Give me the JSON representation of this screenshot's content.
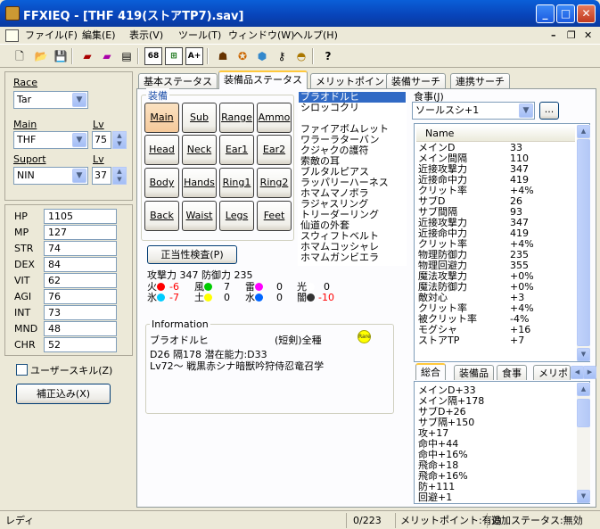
{
  "window": {
    "title": "FFXIEQ - [THF 419(ストアTP7).sav]",
    "min": "_",
    "max": "□",
    "close": "✕"
  },
  "menu": [
    "ファイル(F)",
    "編集(E)",
    "表示(V)",
    "ツール(T)",
    "ウィンドウ(W)",
    "ヘルプ(H)"
  ],
  "mdi": {
    "min": "–",
    "restore": "❐",
    "close": "✕"
  },
  "toolbar": {
    "b68": "68",
    "bA": "A+"
  },
  "left": {
    "race_label": "Race",
    "race_value": "Tar",
    "main_label": "Main",
    "main_value": "THF",
    "lv_label": "Lv",
    "main_lv": "75",
    "support_label": "Suport",
    "support_value": "NIN",
    "support_lv": "37",
    "stats": [
      {
        "name": "HP",
        "value": "1105"
      },
      {
        "name": "MP",
        "value": "127"
      },
      {
        "name": "STR",
        "value": "74"
      },
      {
        "name": "DEX",
        "value": "84"
      },
      {
        "name": "VIT",
        "value": "62"
      },
      {
        "name": "AGI",
        "value": "76"
      },
      {
        "name": "INT",
        "value": "73"
      },
      {
        "name": "MND",
        "value": "48"
      },
      {
        "name": "CHR",
        "value": "52"
      }
    ],
    "user_skill": "ユーザースキル(Z)",
    "correction_button": "補正込み(X)"
  },
  "tabs": [
    "基本ステータス",
    "装備品ステータス",
    "メリットポイント",
    "装備サーチ",
    "連携サーチ"
  ],
  "equip": {
    "group_label": "装備",
    "slots": [
      "Main",
      "Sub",
      "Range",
      "Ammo",
      "Head",
      "Neck",
      "Ear1",
      "Ear2",
      "Body",
      "Hands",
      "Ring1",
      "Ring2",
      "Back",
      "Waist",
      "Legs",
      "Feet"
    ],
    "check_button": "正当性検査(P)",
    "atk_def": "攻撃力 347 防御力 235",
    "elements_row1": [
      {
        "label": "火",
        "value": "-6",
        "color": "#ff0000",
        "vcolor": "#ff0000"
      },
      {
        "label": "風",
        "value": "7",
        "color": "#00cc00",
        "vcolor": "#000000"
      },
      {
        "label": "雷",
        "value": "0",
        "color": "#ff00ff",
        "vcolor": "#000000"
      },
      {
        "label": "光",
        "value": "0",
        "color": "#ffffff",
        "vcolor": "#000000"
      }
    ],
    "elements_row2": [
      {
        "label": "氷",
        "value": "-7",
        "color": "#00ccff",
        "vcolor": "#ff0000"
      },
      {
        "label": "土",
        "value": "0",
        "color": "#ffff00",
        "vcolor": "#000000"
      },
      {
        "label": "水",
        "value": "0",
        "color": "#0066ff",
        "vcolor": "#000000"
      },
      {
        "label": "闇",
        "value": "-10",
        "color": "#333333",
        "vcolor": "#ff0000"
      }
    ],
    "info_label": "Information",
    "info_name": "ブラオドルヒ",
    "info_type": "(短剣)全種",
    "info_badge": "Rare",
    "info_line1": "D26 隔178 潜在能力:D33",
    "info_line2": "Lv72〜 戦黒赤シナ暗獣吟狩侍忍竜召学"
  },
  "item_list": [
    "ブラオドルヒ",
    "シロッコクリ",
    "",
    "ファイアボムレット",
    "ワラーラターバン",
    "クジャクの護符",
    "索敵の耳",
    "ブルタルピアス",
    "ラッパリーハーネス",
    "ホマムマノポラ",
    "ラジャスリング",
    "トリーダーリング",
    "仙道の外套",
    "スウィフトベルト",
    "ホマムコッシャレ",
    "ホマムガンビエラ"
  ],
  "food": {
    "label": "食事(J)",
    "value": "ソールスシ+1",
    "btn": "...",
    "col_name": "Name",
    "rows": [
      [
        "メインD",
        "33"
      ],
      [
        "メイン間隔",
        "110"
      ],
      [
        "近接攻撃力",
        "347"
      ],
      [
        "近接命中力",
        "419"
      ],
      [
        "クリット率",
        "+4%"
      ],
      [
        "サブD",
        "26"
      ],
      [
        "サブ間隔",
        "93"
      ],
      [
        "近接攻撃力",
        "347"
      ],
      [
        "近接命中力",
        "419"
      ],
      [
        "クリット率",
        "+4%"
      ],
      [
        "物理防御力",
        "235"
      ],
      [
        "物理回避力",
        "355"
      ],
      [
        "魔法攻撃力",
        "+0%"
      ],
      [
        "魔法防御力",
        "+0%"
      ],
      [
        "敵対心",
        "+3"
      ],
      [
        "クリット率",
        "+4%"
      ],
      [
        "被クリット率",
        "-4%"
      ],
      [
        "モグシャ",
        "+16"
      ],
      [
        "ストアTP",
        "+7"
      ]
    ]
  },
  "bottom_tabs": [
    "総合",
    "装備品",
    "食事",
    "メリポ"
  ],
  "summary": [
    "メインD+33",
    "メイン隔+178",
    "サブD+26",
    "サブ隔+150",
    "攻+17",
    "命中+44",
    "命中+16%",
    "飛命+18",
    "飛命+16%",
    "防+111",
    "回避+1"
  ],
  "status": {
    "ready": "レディ",
    "count": "0/223",
    "merit": "メリットポイント:有効",
    "extra": "追加ステータス:無効"
  }
}
